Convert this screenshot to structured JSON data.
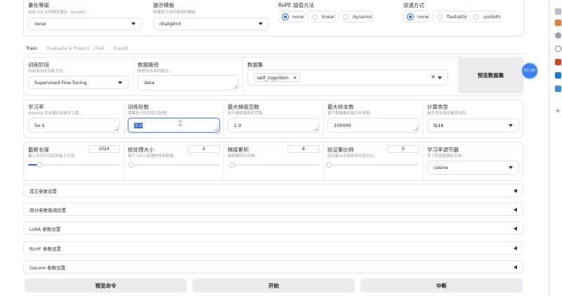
{
  "top": {
    "quant": {
      "label": "量化等级",
      "info": "启用 4/8 比特模型量化（QLoRA）。",
      "value": "none"
    },
    "template": {
      "label": "提示模板",
      "info": "构建提示词时使用的模板",
      "value": "chatglm3"
    },
    "rope": {
      "label": "RoPE 插值方法",
      "options": [
        "none",
        "linear",
        "dynamic"
      ],
      "selected": "none"
    },
    "accel": {
      "label": "加速方式",
      "options": [
        "none",
        "flashattn",
        "unsloth"
      ],
      "selected": "none"
    }
  },
  "tabs": [
    "Train",
    "Evaluate & Predict",
    "Chat",
    "Export"
  ],
  "active_tab": "Train",
  "train": {
    "stage": {
      "label": "训练阶段",
      "info": "目前采用的训练方式。",
      "value": "Supervised Fine-Tuning"
    },
    "data_dir": {
      "label": "数据路径",
      "info": "数据文件夹的路径。",
      "value": "data"
    },
    "dataset": {
      "label": "数据集",
      "chip": "self_cognition",
      "chip_remove": "×",
      "clear": "×"
    },
    "preview_btn": "预览数据集",
    "timer": "07:43",
    "lr": {
      "label": "学习率",
      "info": "AdamW 优化器的初始学习率。",
      "value": "5e-5"
    },
    "epochs": {
      "label": "训练轮数",
      "info": "需要执行的训练总轮数。",
      "value": "3.0"
    },
    "grad_norm": {
      "label": "最大梯度范数",
      "info": "用于梯度裁剪的范数。",
      "value": "1.0"
    },
    "max_samples": {
      "label": "最大样本数",
      "info": "每个数据集的最大样本数。",
      "value": "100000"
    },
    "compute": {
      "label": "计算类型",
      "info": "是否使用混合精度训练。",
      "value": "fp16"
    },
    "cutoff": {
      "label": "截断长度",
      "info": "输入序列分词后的最大长度。",
      "value": "1024",
      "fraction": 0.12
    },
    "batch": {
      "label": "批处理大小",
      "info": "每个 GPU 处理的样本数量。",
      "value": "2",
      "fraction": 0.02
    },
    "grad_acc": {
      "label": "梯度累积",
      "info": "梯度累积的步数。",
      "value": "8",
      "fraction": 0.03
    },
    "val": {
      "label": "验证集比例",
      "info": "验证集占全部样本的百分比。",
      "value": "0",
      "fraction": 0.0
    },
    "scheduler": {
      "label": "学习率调节器",
      "info": "学习率调度器的名称。",
      "value": "cosine"
    }
  },
  "accordions": [
    "其它参数设置",
    "部分参数微调设置",
    "LoRA 参数设置",
    "RLHF 参数设置",
    "GaLore 参数设置"
  ],
  "buttons": {
    "preview_cmd": "预览命令",
    "start": "开始",
    "abort": "中断"
  },
  "colors": {
    "accent": "#2563eb",
    "timer_bg": "#3b82f6",
    "panel_border": "#e6e6e9"
  },
  "sidebar_icons": [
    "bookmark-icon",
    "gift-icon",
    "user-icon",
    "zoom-icon",
    "office-icon",
    "outlook-icon",
    "game-icon",
    "add-icon"
  ]
}
